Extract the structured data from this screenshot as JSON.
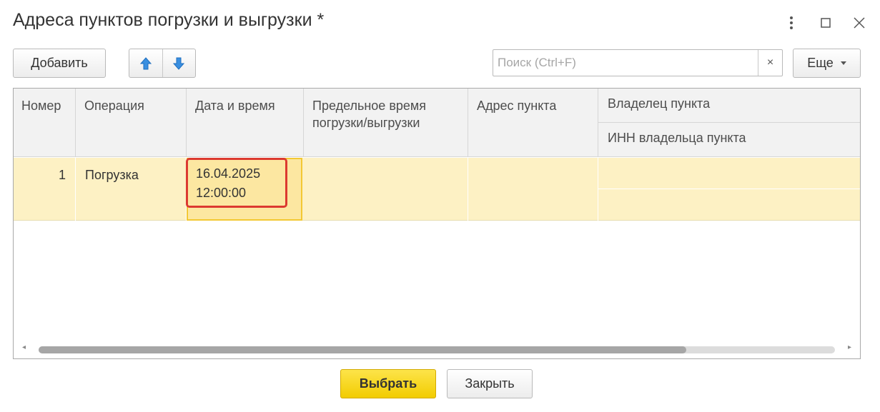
{
  "window": {
    "title": "Адреса пунктов погрузки и выгрузки *",
    "menu_icon": "vertical-dots-icon",
    "maximize_icon": "maximize-icon",
    "close_icon": "close-icon"
  },
  "toolbar": {
    "add_label": "Добавить",
    "move_up_icon": "arrow-up-icon",
    "move_down_icon": "arrow-down-icon",
    "search_placeholder": "Поиск (Ctrl+F)",
    "search_value": "",
    "search_clear": "×",
    "more_label": "Еще"
  },
  "table": {
    "columns": {
      "number": "Номер",
      "operation": "Операция",
      "datetime": "Дата и время",
      "deadline": "Предельное время погрузки/выгрузки",
      "address": "Адрес пункта",
      "owner": "Владелец пункта",
      "owner_inn": "ИНН владельца пункта"
    },
    "rows": [
      {
        "number": "1",
        "operation": "Погрузка",
        "date": "16.04.2025",
        "time": "12:00:00",
        "deadline": "",
        "address": "",
        "owner": "",
        "owner_inn": ""
      }
    ]
  },
  "footer": {
    "select_label": "Выбрать",
    "close_label": "Закрыть"
  },
  "colors": {
    "selected_row": "#fdf1c4",
    "selected_cell": "#fce7a1",
    "highlight_border": "#dc3a30",
    "primary_button": "#f5d20e"
  }
}
